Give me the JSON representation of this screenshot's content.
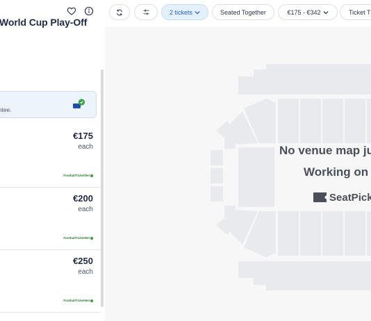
{
  "event": {
    "title": "World Cup Play-Off"
  },
  "guarantee": {
    "text": "antee."
  },
  "listings": [
    {
      "price": "€175",
      "unit": "each",
      "seller": "FootballTicketNet"
    },
    {
      "price": "€200",
      "unit": "each",
      "seller": "FootballTicketNet"
    },
    {
      "price": "€250",
      "unit": "each",
      "seller": "FootballTicketNet"
    }
  ],
  "filters": {
    "tickets": "2 tickets",
    "seated": "Seated Together",
    "price_range": "€175 - €342",
    "ticket_type": "Ticket T"
  },
  "map": {
    "message_line1": "No venue map ju",
    "message_line2": "Working on",
    "brand": "SeatPick"
  },
  "colors": {
    "accent": "#2563c9",
    "chip_active_bg": "#e5f0fd",
    "map_bg": "#f7f7f8",
    "section_fill": "#e9eaed",
    "seller_green": "#2f7a34"
  }
}
